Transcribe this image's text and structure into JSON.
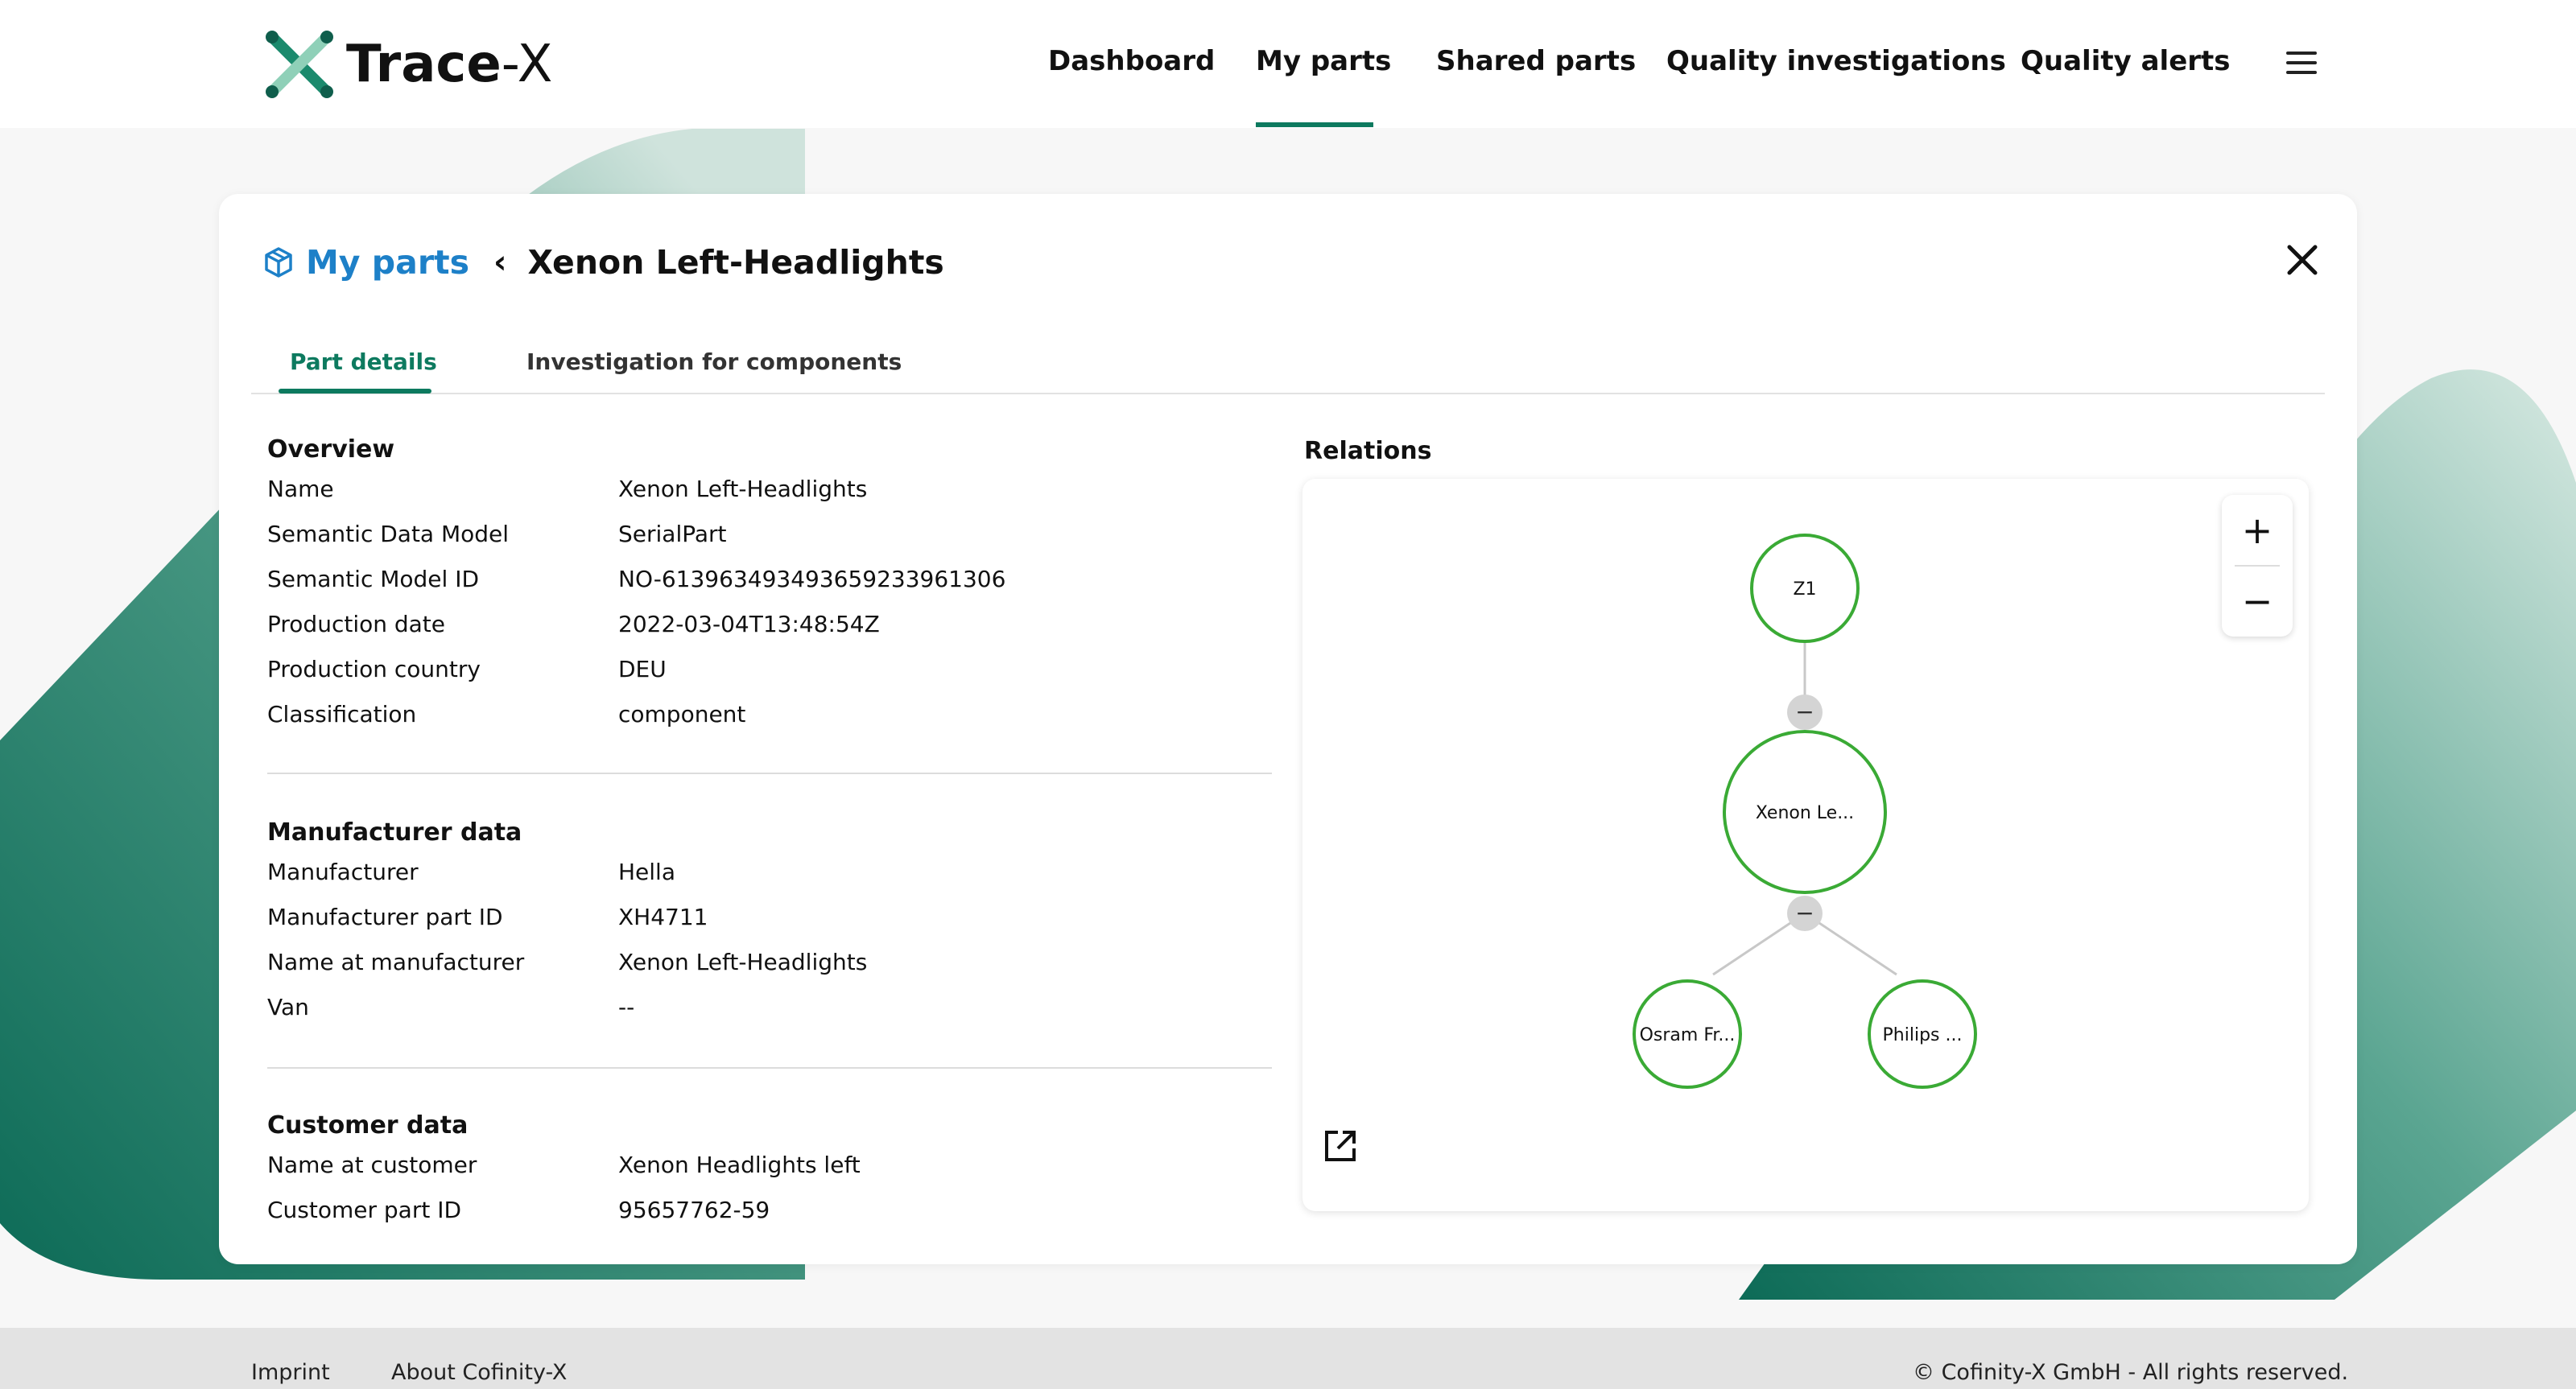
{
  "app": {
    "logo_bold": "Trace",
    "logo_light": "-X"
  },
  "nav": {
    "items": [
      {
        "label": "Dashboard"
      },
      {
        "label": "My parts"
      },
      {
        "label": "Shared parts"
      },
      {
        "label": "Quality investigations"
      },
      {
        "label": "Quality alerts"
      }
    ],
    "active": "My parts"
  },
  "breadcrumb": {
    "parent": "My parts",
    "current": "Xenon Left-Headlights"
  },
  "tabs": [
    {
      "label": "Part details",
      "active": true
    },
    {
      "label": "Investigation for components",
      "active": false
    }
  ],
  "overview": {
    "title": "Overview",
    "rows": [
      {
        "label": "Name",
        "value": "Xenon Left-Headlights"
      },
      {
        "label": "Semantic Data Model",
        "value": "SerialPart"
      },
      {
        "label": "Semantic Model ID",
        "value": "NO-613963493493659233961306"
      },
      {
        "label": "Production date",
        "value": "2022-03-04T13:48:54Z"
      },
      {
        "label": "Production country",
        "value": "DEU"
      },
      {
        "label": "Classification",
        "value": "component"
      }
    ]
  },
  "manufacturer": {
    "title": "Manufacturer data",
    "rows": [
      {
        "label": "Manufacturer",
        "value": "Hella"
      },
      {
        "label": "Manufacturer part ID",
        "value": "XH4711"
      },
      {
        "label": "Name at manufacturer",
        "value": "Xenon Left-Headlights"
      },
      {
        "label": "Van",
        "value": "--"
      }
    ]
  },
  "customer": {
    "title": "Customer data",
    "rows": [
      {
        "label": "Name at customer",
        "value": "Xenon Headlights left"
      },
      {
        "label": "Customer part ID",
        "value": "95657762-59"
      }
    ]
  },
  "relations": {
    "title": "Relations",
    "zoom_in": "+",
    "zoom_out": "−",
    "collapse_glyph": "−",
    "nodes": [
      {
        "id": "z1",
        "label": "Z1"
      },
      {
        "id": "xenon",
        "label": "Xenon Le..."
      },
      {
        "id": "osram",
        "label": "Osram Fr..."
      },
      {
        "id": "philips",
        "label": "Philips ..."
      }
    ]
  },
  "footer": {
    "imprint": "Imprint",
    "about": "About Cofinity-X",
    "copyright": "© Cofinity-X GmbH - All rights reserved."
  },
  "colors": {
    "accent": "#0d7a5f",
    "link": "#1d80c8",
    "node_stroke": "#3aaa35"
  }
}
